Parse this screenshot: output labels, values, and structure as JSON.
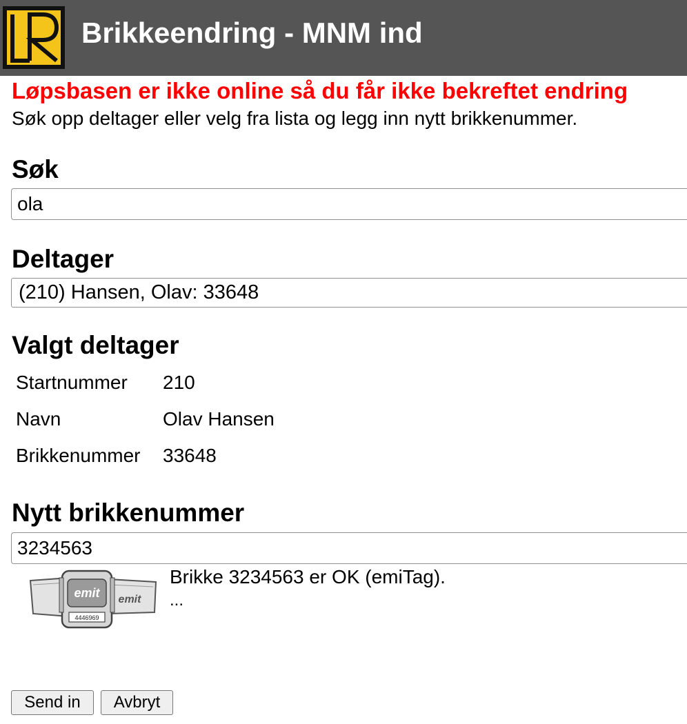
{
  "header": {
    "logo_text": "LR",
    "title": "Brikkeendring - MNM ind"
  },
  "alert": "Løpsbasen er ikke online så du får ikke bekreftet endring",
  "intro": "Søk opp deltager eller velg fra lista og legg inn nytt brikkenummer.",
  "search": {
    "heading": "Søk",
    "value": "ola"
  },
  "participant": {
    "heading": "Deltager",
    "selected": "(210) Hansen, Olav: 33648"
  },
  "selected_participant": {
    "heading": "Valgt deltager",
    "rows": [
      {
        "label": "Startnummer",
        "value": "210"
      },
      {
        "label": "Navn",
        "value": "Olav Hansen"
      },
      {
        "label": "Brikkenummer",
        "value": "33648"
      }
    ]
  },
  "new_chip": {
    "heading": "Nytt brikkenummer",
    "value": "3234563",
    "status": "Brikke 3234563 er OK (emiTag).",
    "extra": "...",
    "image": {
      "brand_left": "emit",
      "brand_right": "emit",
      "serial": "4446969"
    }
  },
  "buttons": {
    "submit": "Send in",
    "cancel": "Avbryt"
  },
  "colors": {
    "header_bg": "#555555",
    "logo_yellow": "#f5c41a",
    "alert_red": "#ff0000"
  }
}
